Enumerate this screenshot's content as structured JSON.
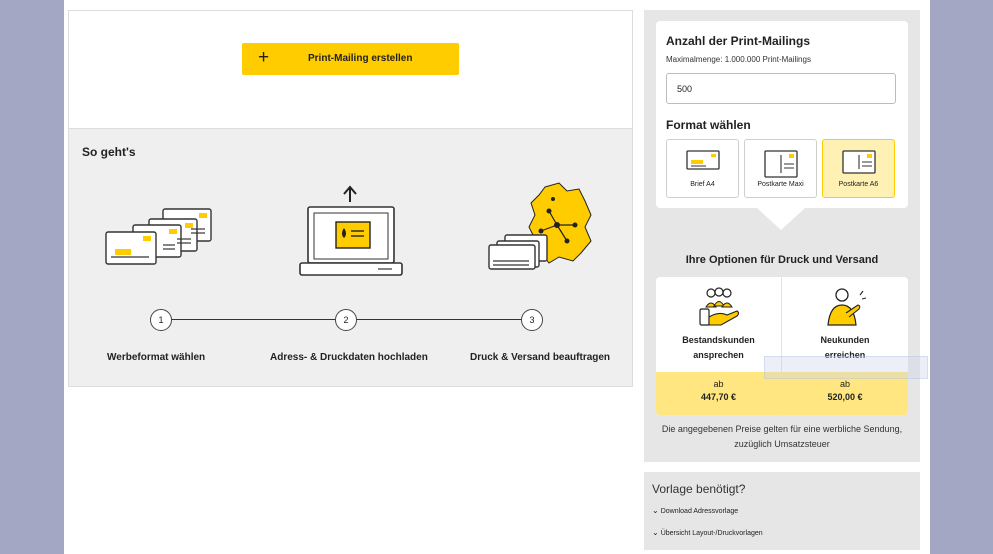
{
  "create": {
    "button_label": "Print-Mailing erstellen"
  },
  "how": {
    "title": "So geht's",
    "steps": [
      {
        "number": "1",
        "label": "Werbeformat wählen"
      },
      {
        "number": "2",
        "label": "Adress- & Druckdaten hochladen"
      },
      {
        "number": "3",
        "label": "Druck & Versand beauftragen"
      }
    ]
  },
  "quantity": {
    "title": "Anzahl der Print-Mailings",
    "subtitle": "Maximalmenge: 1.000.000 Print-Mailings",
    "value": "500"
  },
  "format": {
    "title": "Format wählen",
    "options": [
      {
        "label": "Brief A4",
        "selected": false
      },
      {
        "label": "Postkarte Maxi",
        "selected": false
      },
      {
        "label": "Postkarte A6",
        "selected": true
      }
    ]
  },
  "options": {
    "title": "Ihre Optionen für Druck und Versand",
    "items": [
      {
        "name_line1": "Bestandskunden",
        "name_line2": "ansprechen",
        "prefix": "ab",
        "price": "447,70 €"
      },
      {
        "name_line1": "Neukunden",
        "name_line2": "erreichen",
        "prefix": "ab",
        "price": "520,00 €"
      }
    ],
    "note": "Die angegebenen Preise gelten für eine werbliche Sendung, zuzüglich Umsatzsteuer"
  },
  "template": {
    "title": "Vorlage benötigt?",
    "links": [
      "Download Adressvorlage",
      "Übersicht Layout-/Druckvorlagen"
    ]
  },
  "colors": {
    "accent": "#ffcc00",
    "accent_light": "#ffe680",
    "background": "#a3a7c4"
  }
}
